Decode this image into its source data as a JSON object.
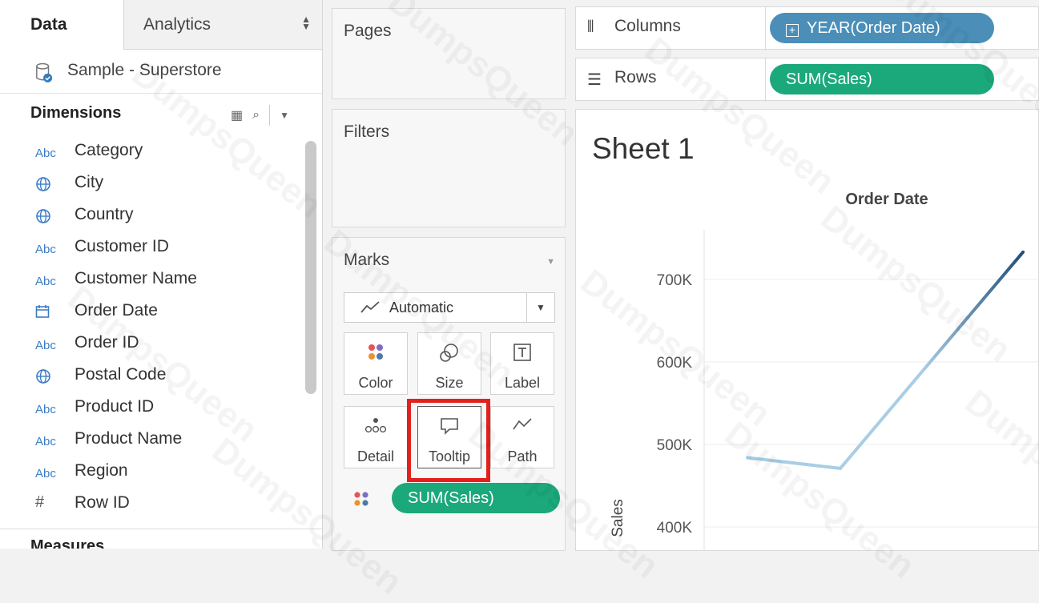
{
  "tabs": {
    "data": "Data",
    "analytics": "Analytics"
  },
  "datasource": {
    "name": "Sample - Superstore"
  },
  "dimensions": {
    "header": "Dimensions",
    "fields": [
      {
        "type": "Abc",
        "icon": "abc-icon",
        "label": "Category"
      },
      {
        "type": "geo",
        "icon": "globe-icon",
        "label": "City"
      },
      {
        "type": "geo",
        "icon": "globe-icon",
        "label": "Country"
      },
      {
        "type": "Abc",
        "icon": "abc-icon",
        "label": "Customer ID"
      },
      {
        "type": "Abc",
        "icon": "abc-icon",
        "label": "Customer Name"
      },
      {
        "type": "date",
        "icon": "calendar-icon",
        "label": "Order Date"
      },
      {
        "type": "Abc",
        "icon": "abc-icon",
        "label": "Order ID"
      },
      {
        "type": "geo",
        "icon": "globe-icon",
        "label": "Postal Code"
      },
      {
        "type": "Abc",
        "icon": "abc-icon",
        "label": "Product ID"
      },
      {
        "type": "Abc",
        "icon": "abc-icon",
        "label": "Product Name"
      },
      {
        "type": "Abc",
        "icon": "abc-icon",
        "label": "Region"
      },
      {
        "type": "num",
        "icon": "hash-icon",
        "label": "Row ID"
      }
    ]
  },
  "measures": {
    "header": "Measures"
  },
  "cards": {
    "pages": "Pages",
    "filters": "Filters",
    "marks": "Marks"
  },
  "marks": {
    "type": "Automatic",
    "buttons": [
      "Color",
      "Size",
      "Label",
      "Detail",
      "Tooltip",
      "Path"
    ],
    "pill": "SUM(Sales)"
  },
  "shelves": {
    "columns_label": "Columns",
    "columns_pill": "YEAR(Order Date)",
    "rows_label": "Rows",
    "rows_pill": "SUM(Sales)"
  },
  "view": {
    "title": "Sheet 1"
  },
  "colors": {
    "accent_green": "#1ba87a",
    "accent_blue": "#4b8fb8",
    "highlight": "#e3211c"
  },
  "chart_data": {
    "type": "line",
    "title": "",
    "header": "Order Date",
    "ylabel": "Sales",
    "ytick_labels": [
      "400K",
      "500K",
      "600K",
      "700K"
    ],
    "yticks": [
      400000,
      500000,
      600000,
      700000
    ],
    "ylim": [
      370000,
      760000
    ],
    "x": [
      1,
      2,
      3
    ],
    "values": [
      484000,
      471000,
      733000
    ],
    "grid": true,
    "line_colors": [
      "#a9cde6",
      "#1f4e79"
    ]
  },
  "watermark": "DumpsQueen"
}
